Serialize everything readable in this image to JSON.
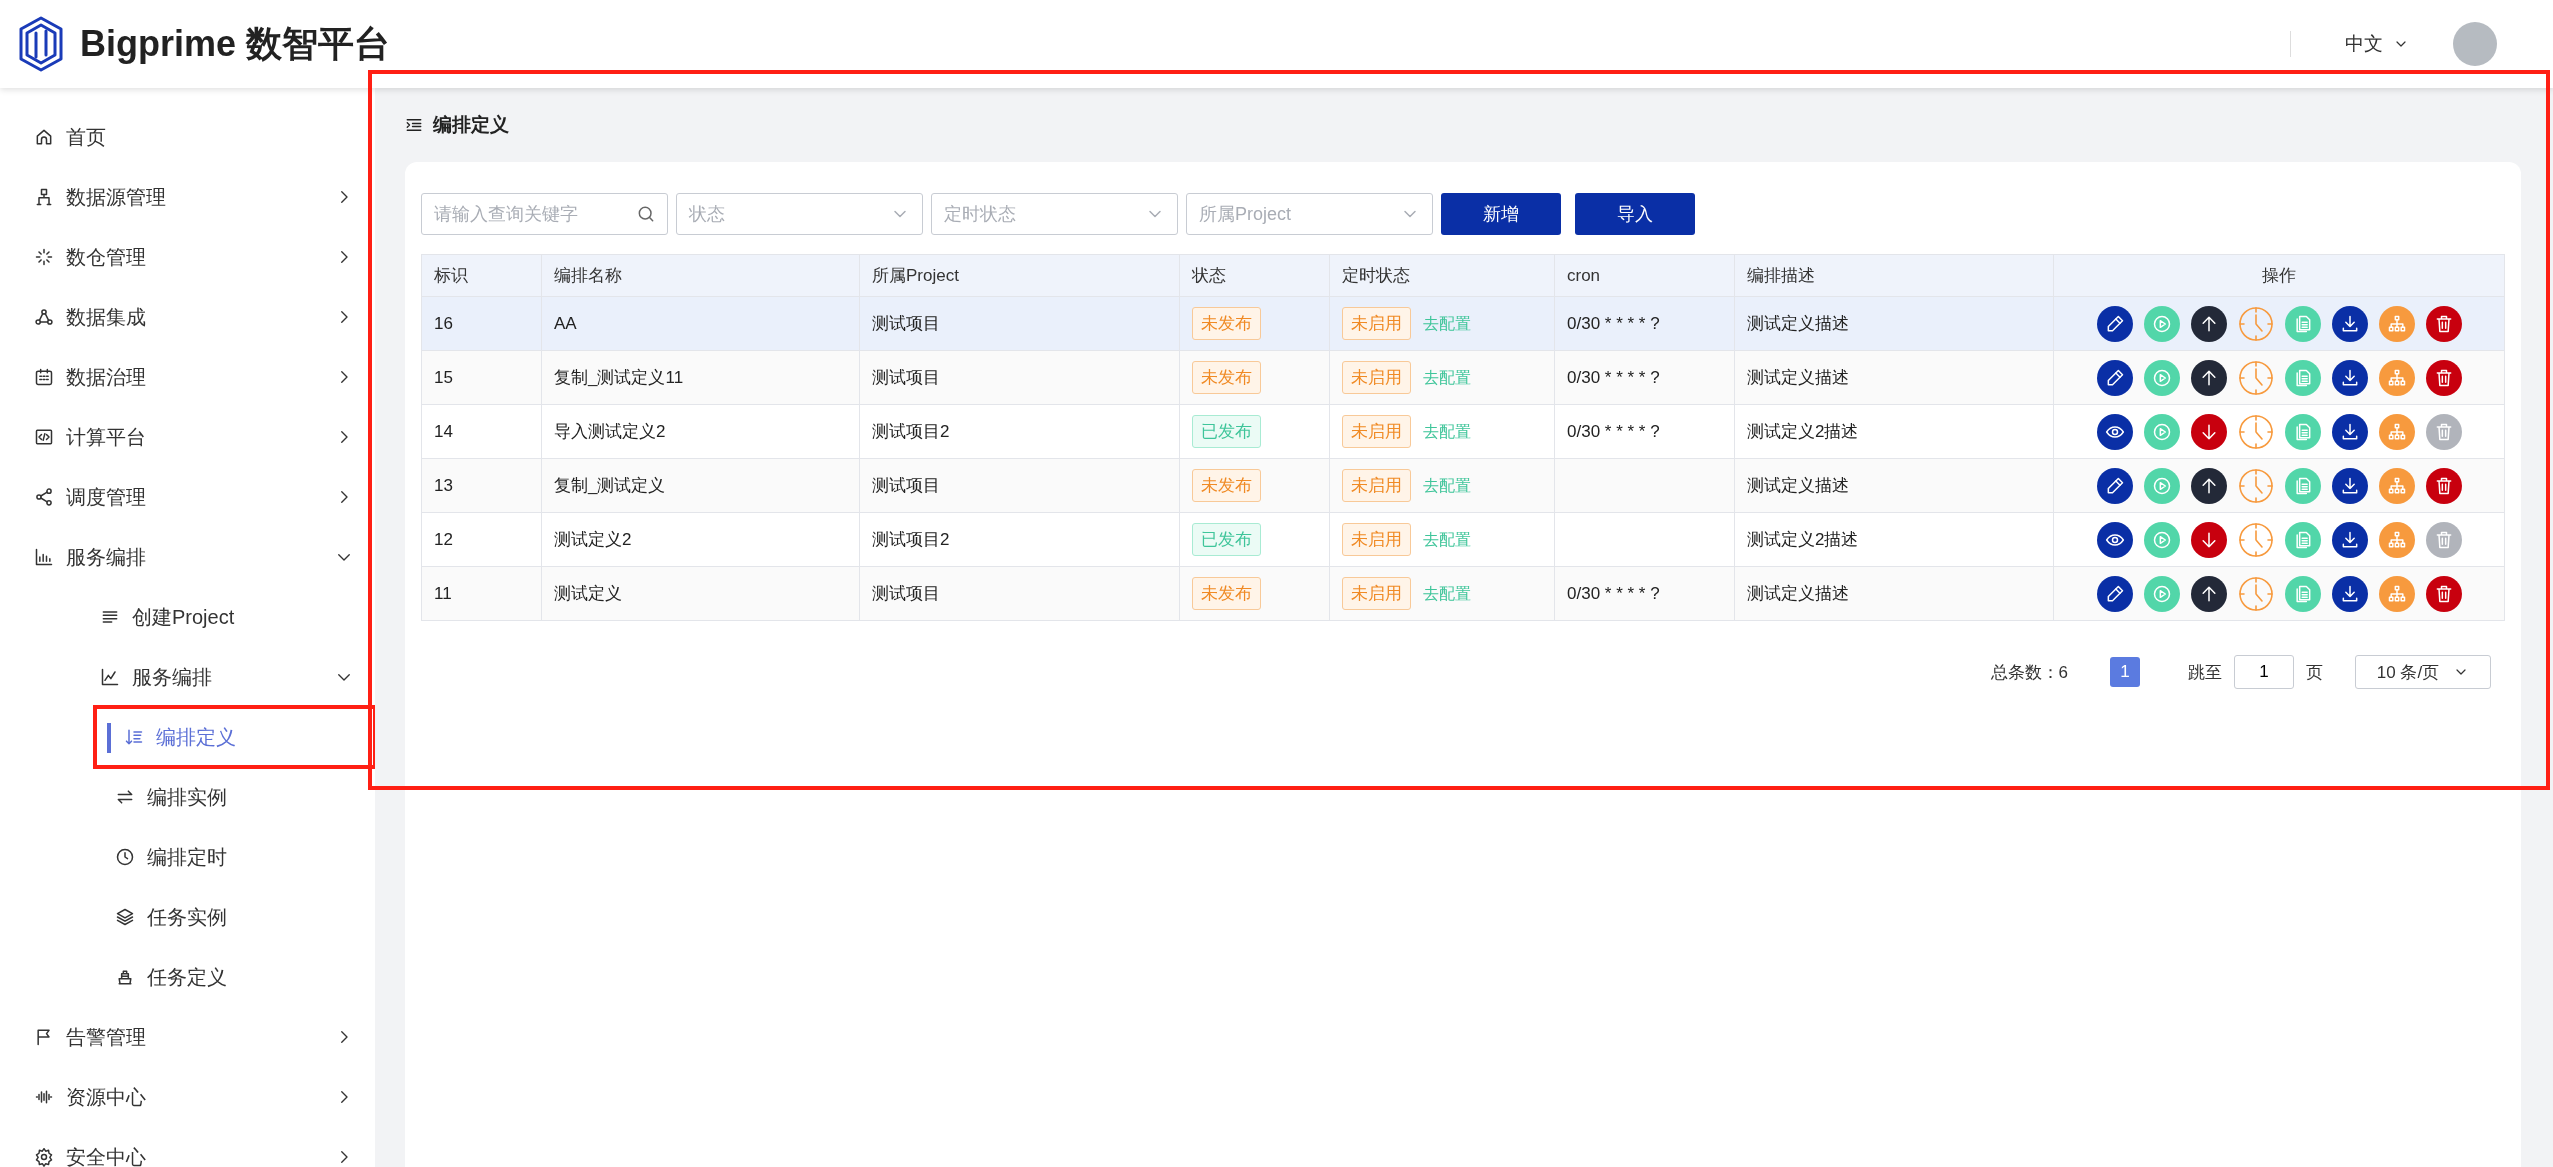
{
  "header": {
    "logo_text": "Bigprime 数智平台",
    "language": "中文"
  },
  "sidebar": {
    "items": [
      {
        "label": "首页",
        "selected": false
      },
      {
        "label": "数据源管理",
        "expanded": false,
        "selected": false
      },
      {
        "label": "数仓管理",
        "expanded": false,
        "selected": false
      },
      {
        "label": "数据集成",
        "expanded": false,
        "selected": false
      },
      {
        "label": "数据治理",
        "expanded": false,
        "selected": false
      },
      {
        "label": "计算平台",
        "expanded": false,
        "selected": false
      },
      {
        "label": "调度管理",
        "expanded": false,
        "selected": false
      },
      {
        "label": "服务编排",
        "expanded": true,
        "selected": false,
        "children": [
          {
            "label": "创建Project",
            "selected": false
          },
          {
            "label": "服务编排",
            "expanded": true,
            "selected": false,
            "children": [
              {
                "label": "编排定义",
                "selected": true
              },
              {
                "label": "编排实例",
                "selected": false
              },
              {
                "label": "编排定时",
                "selected": false
              },
              {
                "label": "任务实例",
                "selected": false
              },
              {
                "label": "任务定义",
                "selected": false
              }
            ]
          }
        ]
      },
      {
        "label": "告警管理",
        "expanded": false,
        "selected": false
      },
      {
        "label": "资源中心",
        "expanded": false,
        "selected": false
      },
      {
        "label": "安全中心",
        "expanded": false,
        "selected": false
      }
    ]
  },
  "page_title": "编排定义",
  "filters": {
    "search": {
      "placeholder": "请输入查询关键字"
    },
    "selects": [
      {
        "placeholder": "状态"
      },
      {
        "placeholder": "定时状态"
      },
      {
        "placeholder": "所属Project"
      }
    ],
    "buttons": [
      "新增",
      "导入"
    ]
  },
  "table": {
    "columns": [
      "标识",
      "编排名称",
      "所属Project",
      "状态",
      "定时状态",
      "cron",
      "编排描述",
      "操作"
    ],
    "rows": [
      {
        "id": "16",
        "name": "AA",
        "project": "测试项目",
        "status": {
          "text": "未发布",
          "kind": "unpublished"
        },
        "schedule": {
          "text": "未启用",
          "kind": "off"
        },
        "schedule_link": "去配置",
        "cron": "0/30 * * * * ?",
        "description": "测试定义描述",
        "hovered": true,
        "actions": [
          {
            "kind": "edit",
            "disabled": false
          },
          {
            "kind": "run",
            "disabled": false
          },
          {
            "kind": "publish",
            "disabled": false
          },
          {
            "kind": "schedule",
            "disabled": false
          },
          {
            "kind": "copy",
            "disabled": false
          },
          {
            "kind": "export",
            "disabled": false
          },
          {
            "kind": "lineage",
            "disabled": false
          },
          {
            "kind": "delete",
            "disabled": false
          }
        ]
      },
      {
        "id": "15",
        "name": "复制_测试定义11",
        "project": "测试项目",
        "status": {
          "text": "未发布",
          "kind": "unpublished"
        },
        "schedule": {
          "text": "未启用",
          "kind": "off"
        },
        "schedule_link": "去配置",
        "cron": "0/30 * * * * ?",
        "description": "测试定义描述",
        "hovered": false,
        "actions": [
          {
            "kind": "edit",
            "disabled": false
          },
          {
            "kind": "run",
            "disabled": false
          },
          {
            "kind": "publish",
            "disabled": false
          },
          {
            "kind": "schedule",
            "disabled": false
          },
          {
            "kind": "copy",
            "disabled": false
          },
          {
            "kind": "export",
            "disabled": false
          },
          {
            "kind": "lineage",
            "disabled": false
          },
          {
            "kind": "delete",
            "disabled": false
          }
        ]
      },
      {
        "id": "14",
        "name": "导入测试定义2",
        "project": "测试项目2",
        "status": {
          "text": "已发布",
          "kind": "published"
        },
        "schedule": {
          "text": "未启用",
          "kind": "off"
        },
        "schedule_link": "去配置",
        "cron": "0/30 * * * * ?",
        "description": "测试定义2描述",
        "hovered": false,
        "actions": [
          {
            "kind": "view",
            "disabled": false
          },
          {
            "kind": "run",
            "disabled": false
          },
          {
            "kind": "unpublish",
            "disabled": false
          },
          {
            "kind": "schedule",
            "disabled": false
          },
          {
            "kind": "copy",
            "disabled": false
          },
          {
            "kind": "export",
            "disabled": false
          },
          {
            "kind": "lineage",
            "disabled": false
          },
          {
            "kind": "delete",
            "disabled": true
          }
        ]
      },
      {
        "id": "13",
        "name": "复制_测试定义",
        "project": "测试项目",
        "status": {
          "text": "未发布",
          "kind": "unpublished"
        },
        "schedule": {
          "text": "未启用",
          "kind": "off"
        },
        "schedule_link": "去配置",
        "description": "测试定义描述",
        "hovered": false,
        "actions": [
          {
            "kind": "edit",
            "disabled": false
          },
          {
            "kind": "run",
            "disabled": false
          },
          {
            "kind": "publish",
            "disabled": false
          },
          {
            "kind": "schedule",
            "disabled": false
          },
          {
            "kind": "copy",
            "disabled": false
          },
          {
            "kind": "export",
            "disabled": false
          },
          {
            "kind": "lineage",
            "disabled": false
          },
          {
            "kind": "delete",
            "disabled": false
          }
        ]
      },
      {
        "id": "12",
        "name": "测试定义2",
        "project": "测试项目2",
        "status": {
          "text": "已发布",
          "kind": "published"
        },
        "schedule": {
          "text": "未启用",
          "kind": "off"
        },
        "schedule_link": "去配置",
        "description": "测试定义2描述",
        "hovered": false,
        "actions": [
          {
            "kind": "view",
            "disabled": false
          },
          {
            "kind": "run",
            "disabled": false
          },
          {
            "kind": "unpublish",
            "disabled": false
          },
          {
            "kind": "schedule",
            "disabled": false
          },
          {
            "kind": "copy",
            "disabled": false
          },
          {
            "kind": "export",
            "disabled": false
          },
          {
            "kind": "lineage",
            "disabled": false
          },
          {
            "kind": "delete",
            "disabled": true
          }
        ]
      },
      {
        "id": "11",
        "name": "测试定义",
        "project": "测试项目",
        "status": {
          "text": "未发布",
          "kind": "unpublished"
        },
        "schedule": {
          "text": "未启用",
          "kind": "off"
        },
        "schedule_link": "去配置",
        "cron": "0/30 * * * * ?",
        "description": "测试定义描述",
        "hovered": false,
        "actions": [
          {
            "kind": "edit",
            "disabled": false
          },
          {
            "kind": "run",
            "disabled": false
          },
          {
            "kind": "publish",
            "disabled": false
          },
          {
            "kind": "schedule",
            "disabled": false
          },
          {
            "kind": "copy",
            "disabled": false
          },
          {
            "kind": "export",
            "disabled": false
          },
          {
            "kind": "lineage",
            "disabled": false
          },
          {
            "kind": "delete",
            "disabled": false
          }
        ]
      }
    ]
  },
  "pagination": {
    "total": "总条数：6",
    "pages": [
      {
        "label": "1",
        "selected": true
      }
    ],
    "jump_label": "跳至",
    "jump_value": "1",
    "page_unit": "页",
    "page_size": "10 条/页"
  },
  "annotation_frames": {
    "around_content": true,
    "around_selected_menu_item": true
  }
}
